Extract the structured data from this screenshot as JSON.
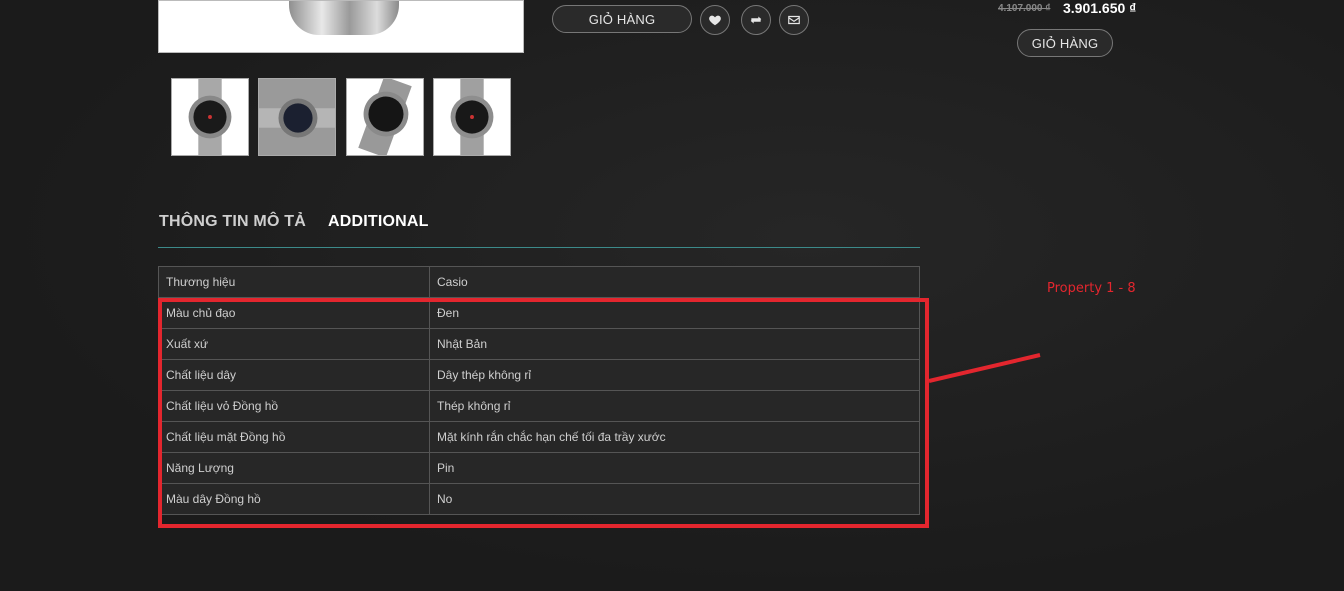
{
  "product": {
    "buttons": {
      "cart_main": "GIỎ HÀNG",
      "wishlist_icon": "heart-icon",
      "compare_icon": "refresh-icon",
      "email_icon": "envelope-icon"
    },
    "thumbnails": [
      "watch-thumbnail-1",
      "watch-thumbnail-2",
      "watch-thumbnail-3",
      "watch-thumbnail-4"
    ]
  },
  "sidebar": {
    "price_old": "4.107.000 ₫",
    "price_new": "3.901.650 ₫",
    "cart_label": "GIỎ HÀNG"
  },
  "tabs": [
    {
      "label": "THÔNG TIN MÔ TẢ",
      "active": false
    },
    {
      "label": "ADDITIONAL",
      "active": true
    }
  ],
  "properties": [
    {
      "key": "Thương hiệu",
      "value": "Casio"
    },
    {
      "key": "Màu chủ đạo",
      "value": "Đen"
    },
    {
      "key": "Xuất xứ",
      "value": "Nhật Bản"
    },
    {
      "key": "Chất liệu dây",
      "value": "Dây thép không rỉ"
    },
    {
      "key": "Chất liệu vỏ Đồng hồ",
      "value": "Thép không rỉ"
    },
    {
      "key": "Chất liệu mặt Đồng hồ",
      "value": "Mặt kính rắn chắc hạn chế tối đa trầy xước"
    },
    {
      "key": "Năng Lượng",
      "value": "Pin"
    },
    {
      "key": "Màu dây Đồng hồ",
      "value": "No"
    }
  ],
  "annotation": {
    "label": "Property 1 - 8",
    "color": "#e3262e"
  }
}
